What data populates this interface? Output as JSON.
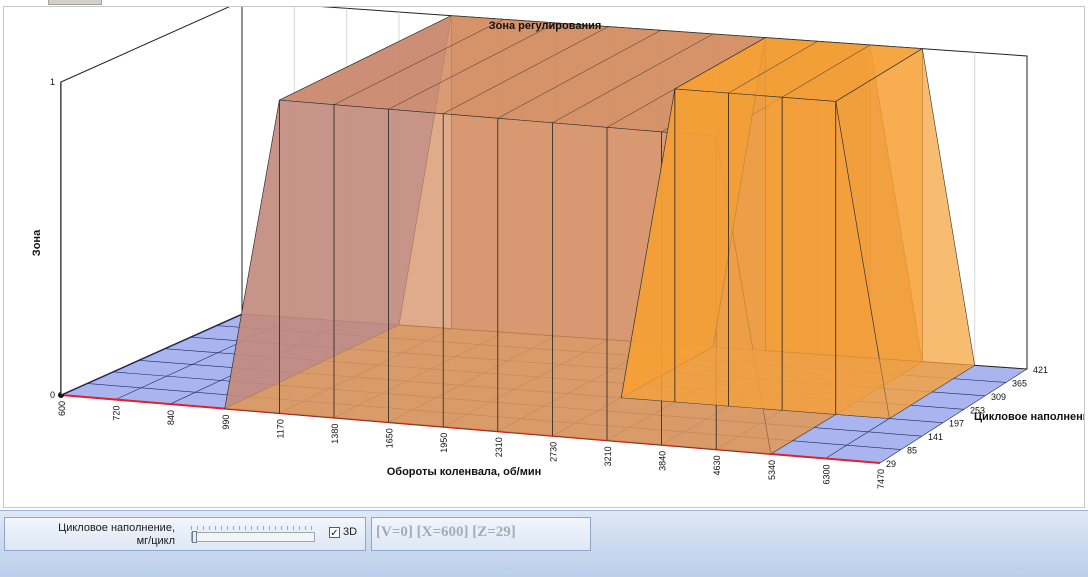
{
  "chart_data": {
    "type": "3d-surface",
    "title": "Зона регулирования",
    "xlabel": "Обороты коленвала, об/мин",
    "ylabel": "Зона",
    "zlabel": "Цикловое наполнение",
    "x_ticks": [
      "600",
      "720",
      "840",
      "990",
      "1170",
      "1380",
      "1650",
      "1950",
      "2310",
      "2730",
      "3210",
      "3840",
      "4630",
      "5340",
      "6300",
      "7470"
    ],
    "z_ticks": [
      "29",
      "85",
      "141",
      "197",
      "253",
      "309",
      "365",
      "421"
    ],
    "y_ticks": [
      "0",
      "1"
    ],
    "zones": [
      {
        "rpm_from": 1170,
        "rpm_to": 4630,
        "fill_from": 29,
        "fill_to": 421,
        "value": 1
      },
      {
        "rpm_from": 3210,
        "rpm_to": 5340,
        "fill_from": 197,
        "fill_to": 421,
        "value": 1
      }
    ],
    "colors": {
      "floor": "#aab4ee",
      "zone": "#d28a5e",
      "zone_hi": "#f5a035",
      "axis_x": "#e0202a",
      "axis_z": "#2838c8"
    }
  },
  "controls": {
    "fill_label": "Цикловое наполнение,\nмг/цикл",
    "checkbox_label": "3D",
    "checkbox_mark": "✓",
    "coords_text": "[V=0] [X=600] [Z=29]",
    "slider_fraction": 0
  }
}
